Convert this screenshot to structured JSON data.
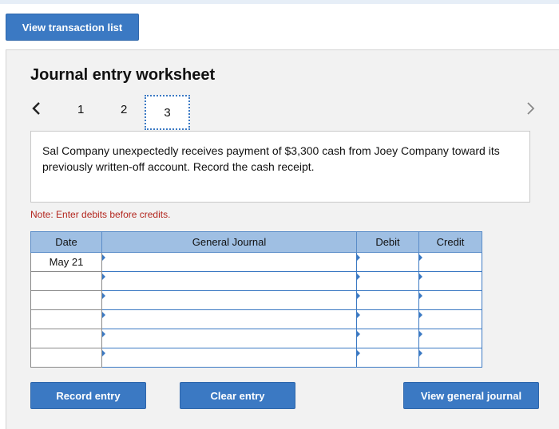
{
  "toolbar": {
    "view_transaction_list": "View transaction list"
  },
  "worksheet": {
    "title": "Journal entry worksheet",
    "pages": [
      "1",
      "2",
      "3"
    ],
    "current_page": "3",
    "scenario": "Sal Company unexpectedly receives payment of $3,300 cash from Joey Company toward its previously written-off account. Record the cash receipt.",
    "note": "Note: Enter debits before credits."
  },
  "table": {
    "headers": {
      "date": "Date",
      "general_journal": "General Journal",
      "debit": "Debit",
      "credit": "Credit"
    },
    "rows": [
      {
        "date": "May 21",
        "account": "",
        "debit": "",
        "credit": ""
      },
      {
        "date": "",
        "account": "",
        "debit": "",
        "credit": ""
      },
      {
        "date": "",
        "account": "",
        "debit": "",
        "credit": ""
      },
      {
        "date": "",
        "account": "",
        "debit": "",
        "credit": ""
      },
      {
        "date": "",
        "account": "",
        "debit": "",
        "credit": ""
      },
      {
        "date": "",
        "account": "",
        "debit": "",
        "credit": ""
      }
    ]
  },
  "actions": {
    "record_entry": "Record entry",
    "clear_entry": "Clear entry",
    "view_general_journal": "View general journal"
  },
  "colors": {
    "button_blue": "#3b79c3",
    "header_blue": "#9fbfe3",
    "note_red": "#b3261e",
    "panel_gray": "#f2f2f2"
  },
  "icons": {
    "prev": "chevron-left-icon",
    "next": "chevron-right-icon"
  }
}
